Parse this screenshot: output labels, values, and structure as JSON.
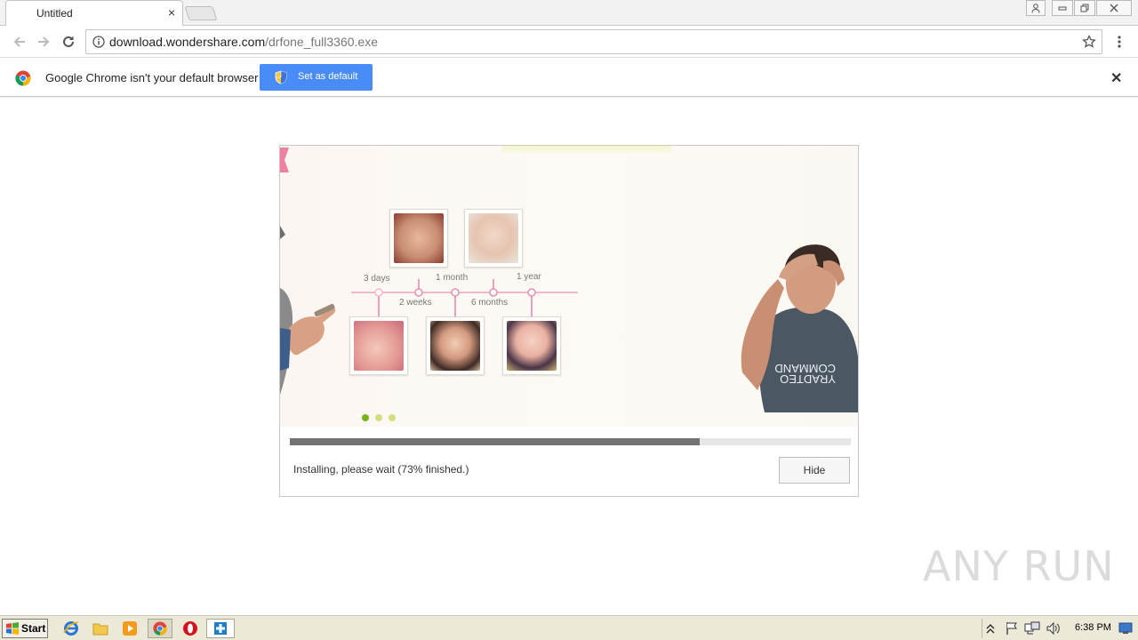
{
  "browser": {
    "tab_title": "Untitled",
    "tab_close": "×",
    "url_host": "download.wondershare.com",
    "url_path": "/drfone_full3360.exe",
    "accent": "#4a8cf7"
  },
  "infobar": {
    "message": "Google Chrome isn't your default browser",
    "button_label": "Set as default",
    "close": "✕"
  },
  "installer": {
    "timeline": {
      "labels": [
        "3 days",
        "1 month",
        "1 year",
        "2 weeks",
        "6 months"
      ]
    },
    "carousel_dots": 3,
    "carousel_active": 0,
    "progress_percent": 73,
    "status_text": "Installing, please wait (73% finished.)",
    "hide_label": "Hide"
  },
  "watermark": "ANY RUN",
  "taskbar": {
    "start_label": "Start",
    "clock": "6:38 PM",
    "apps": [
      "ie-icon",
      "folder-icon",
      "media-player-icon",
      "chrome-icon",
      "opera-icon",
      "installer-icon"
    ]
  }
}
